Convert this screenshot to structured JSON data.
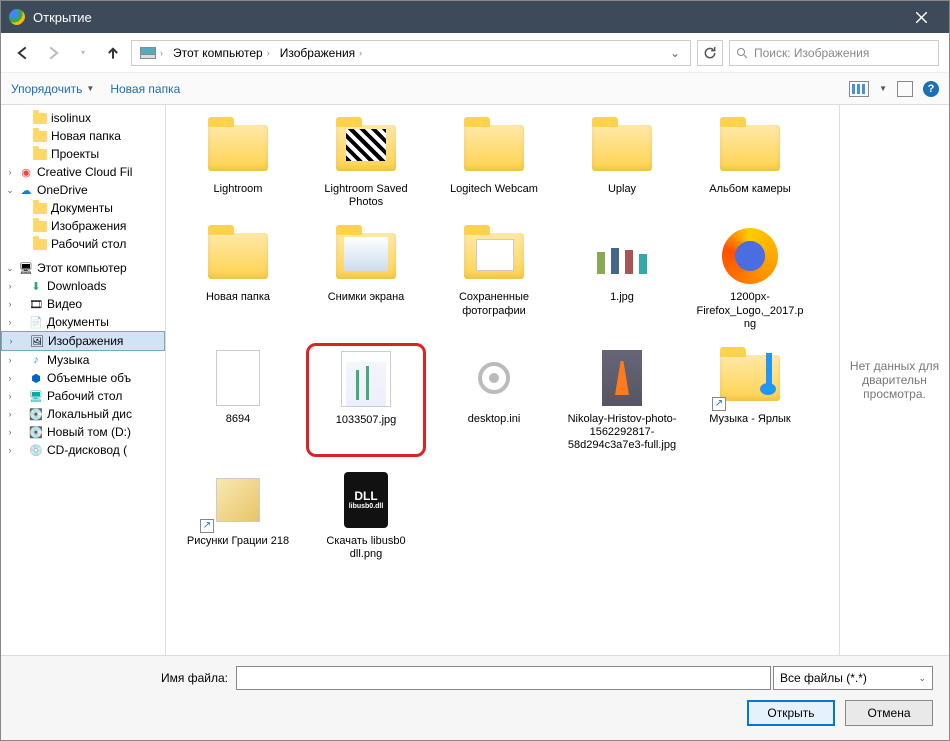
{
  "window": {
    "title": "Открытие"
  },
  "breadcrumb": {
    "root": "Этот компьютер",
    "current": "Изображения"
  },
  "search": {
    "placeholder": "Поиск: Изображения"
  },
  "toolbar": {
    "organize": "Упорядочить",
    "newfolder": "Новая папка"
  },
  "tree": {
    "isolinux": "isolinux",
    "newfolder": "Новая папка",
    "projects": "Проекты",
    "ccfiles": "Creative Cloud Fil",
    "onedrive": "OneDrive",
    "od_docs": "Документы",
    "od_images": "Изображения",
    "od_desktop": "Рабочий стол",
    "thispc": "Этот компьютер",
    "downloads": "Downloads",
    "video": "Видео",
    "docs": "Документы",
    "images": "Изображения",
    "music": "Музыка",
    "volumes": "Объемные объ",
    "desktop": "Рабочий стол",
    "localdisk": "Локальный дис",
    "newvol": "Новый том (D:)",
    "cddrive": "CD-дисковод ("
  },
  "items": {
    "lightroom": "Lightroom",
    "lrsaved": "Lightroom Saved Photos",
    "logitech": "Logitech Webcam",
    "uplay": "Uplay",
    "camera": "Альбом камеры",
    "newfolder": "Новая папка",
    "screenshots": "Снимки экрана",
    "savedphotos": "Сохраненные фотографии",
    "one": "1.jpg",
    "firefox": "1200px-Firefox_Logo,_2017.png",
    "n8694": "8694",
    "selected": "1033507.jpg",
    "desktopini": "desktop.ini",
    "nikolay": "Nikolay-Hristov-photo-1562292817-58d294c3a7e3-full.jpg",
    "musiclink": "Музыка - Ярлык",
    "gratsia": "Рисунки Грации 218",
    "libusb": "Скачать libusb0 dll.png"
  },
  "preview": {
    "nodata": "Нет данных для дварительн просмотра."
  },
  "footer": {
    "filename_label": "Имя файла:",
    "filename_value": "",
    "filter": "Все файлы (*.*)",
    "open": "Открыть",
    "cancel": "Отмена"
  }
}
